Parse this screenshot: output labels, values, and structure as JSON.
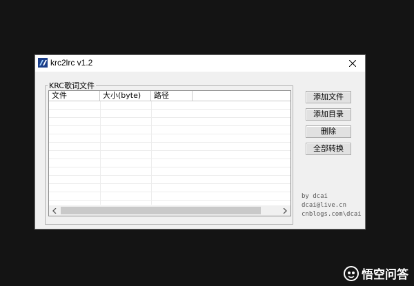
{
  "window": {
    "title": "krc2lrc v1.2"
  },
  "group": {
    "label": "KRC歌词文件"
  },
  "list": {
    "columns": [
      "文件",
      "大小(byte)",
      "路径"
    ]
  },
  "buttons": {
    "add_file": "添加文件",
    "add_dir": "添加目录",
    "delete": "删除",
    "convert_all": "全部转换"
  },
  "credits": {
    "line1": "by dcai",
    "line2": "dcai@live.cn",
    "line3": "cnblogs.com\\dcai"
  },
  "watermark": {
    "text": "悟空问答"
  },
  "icons": {
    "app": "krc-app-icon",
    "close": "close-icon",
    "scroll_left": "chevron-left-icon",
    "scroll_right": "chevron-right-icon",
    "watermark_logo": "wukong-logo-icon"
  }
}
